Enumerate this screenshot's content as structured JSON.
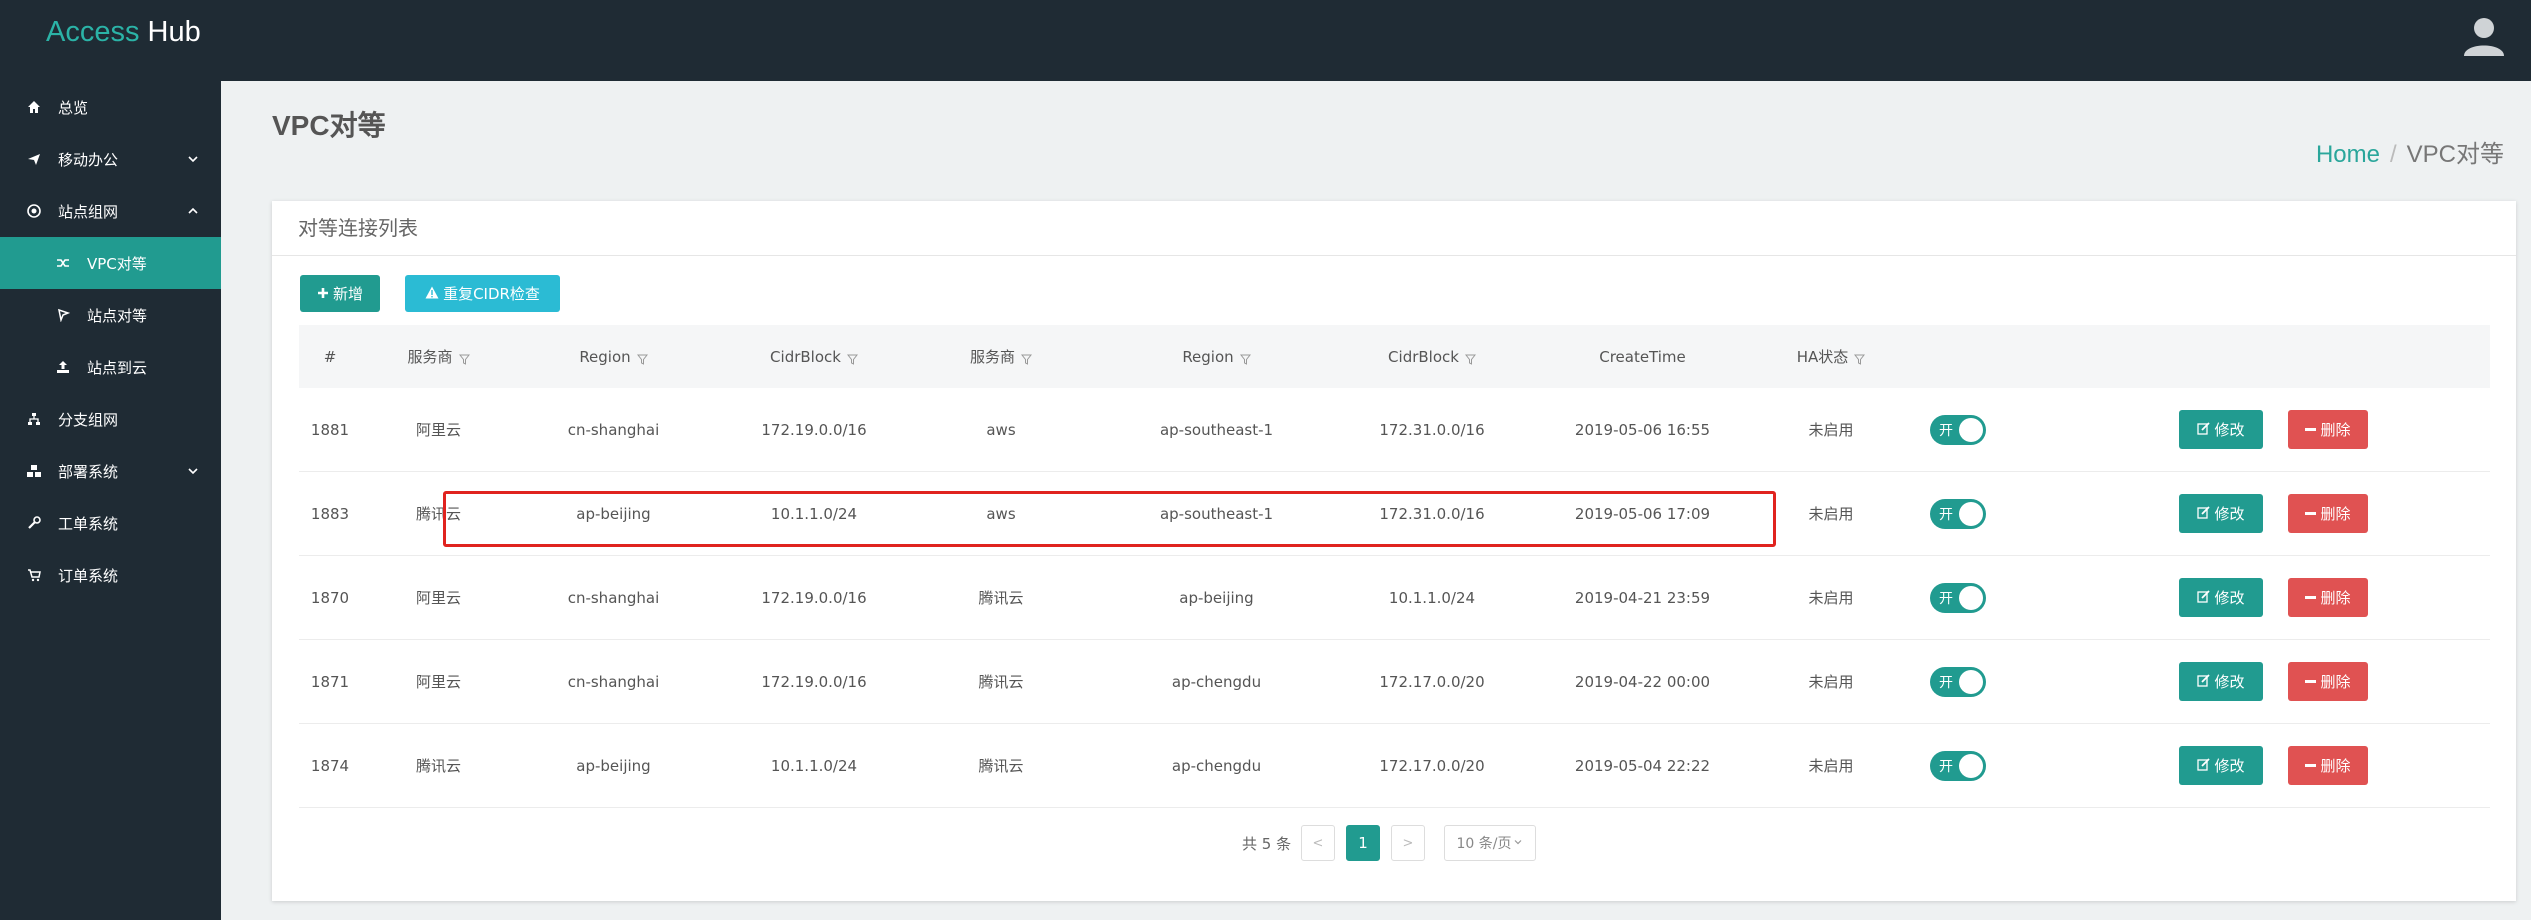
{
  "app": {
    "brand_part1": "Access",
    "brand_part2": "Hub"
  },
  "sidebar": {
    "items": [
      {
        "label": "总览",
        "icon": "home-icon"
      },
      {
        "label": "移动办公",
        "icon": "plane-icon",
        "chevron": "down"
      },
      {
        "label": "站点组网",
        "icon": "gear-icon",
        "chevron": "up"
      },
      {
        "label": "VPC对等",
        "icon": "shuffle-icon",
        "sub": true,
        "active": true
      },
      {
        "label": "站点对等",
        "icon": "location-icon",
        "sub": true
      },
      {
        "label": "站点到云",
        "icon": "upload-icon",
        "sub": true
      },
      {
        "label": "分支组网",
        "icon": "sitemap-icon"
      },
      {
        "label": "部署系统",
        "icon": "cubes-icon",
        "chevron": "down"
      },
      {
        "label": "工单系统",
        "icon": "wrench-icon"
      },
      {
        "label": "订单系统",
        "icon": "cart-icon"
      }
    ]
  },
  "page": {
    "title": "VPC对等"
  },
  "breadcrumb": {
    "home": "Home",
    "separator": "/",
    "current": "VPC对等"
  },
  "card": {
    "title": "对等连接列表"
  },
  "toolbar": {
    "add_label": "新增",
    "cidr_check_label": "重复CIDR检查"
  },
  "table": {
    "columns": [
      "#",
      "服务商",
      "Region",
      "CidrBlock",
      "服务商",
      "Region",
      "CidrBlock",
      "CreateTime",
      "HA状态"
    ],
    "rows": [
      {
        "id": "1881",
        "provider1": "阿里云",
        "region1": "cn-shanghai",
        "cidr1": "172.19.0.0/16",
        "provider2": "aws",
        "region2": "ap-southeast-1",
        "cidr2": "172.31.0.0/16",
        "create_time": "2019-05-06 16:55",
        "ha": "未启用",
        "toggle": "开",
        "edit": "修改",
        "delete": "删除"
      },
      {
        "id": "1883",
        "provider1": "腾讯云",
        "region1": "ap-beijing",
        "cidr1": "10.1.1.0/24",
        "provider2": "aws",
        "region2": "ap-southeast-1",
        "cidr2": "172.31.0.0/16",
        "create_time": "2019-05-06 17:09",
        "ha": "未启用",
        "toggle": "开",
        "edit": "修改",
        "delete": "删除"
      },
      {
        "id": "1870",
        "provider1": "阿里云",
        "region1": "cn-shanghai",
        "cidr1": "172.19.0.0/16",
        "provider2": "腾讯云",
        "region2": "ap-beijing",
        "cidr2": "10.1.1.0/24",
        "create_time": "2019-04-21 23:59",
        "ha": "未启用",
        "toggle": "开",
        "edit": "修改",
        "delete": "删除"
      },
      {
        "id": "1871",
        "provider1": "阿里云",
        "region1": "cn-shanghai",
        "cidr1": "172.19.0.0/16",
        "provider2": "腾讯云",
        "region2": "ap-chengdu",
        "cidr2": "172.17.0.0/20",
        "create_time": "2019-04-22 00:00",
        "ha": "未启用",
        "toggle": "开",
        "edit": "修改",
        "delete": "删除"
      },
      {
        "id": "1874",
        "provider1": "腾讯云",
        "region1": "ap-beijing",
        "cidr1": "10.1.1.0/24",
        "provider2": "腾讯云",
        "region2": "ap-chengdu",
        "cidr2": "172.17.0.0/20",
        "create_time": "2019-05-04 22:22",
        "ha": "未启用",
        "toggle": "开",
        "edit": "修改",
        "delete": "删除"
      }
    ]
  },
  "pagination": {
    "total": "共 5 条",
    "prev": "<",
    "current_page": "1",
    "next": ">",
    "page_size": "10 条/页"
  },
  "colors": {
    "header_bg": "#1f2b34",
    "accent": "#219b90",
    "danger": "#e05252",
    "info": "#2bbbd4",
    "highlight": "#e0231f"
  }
}
